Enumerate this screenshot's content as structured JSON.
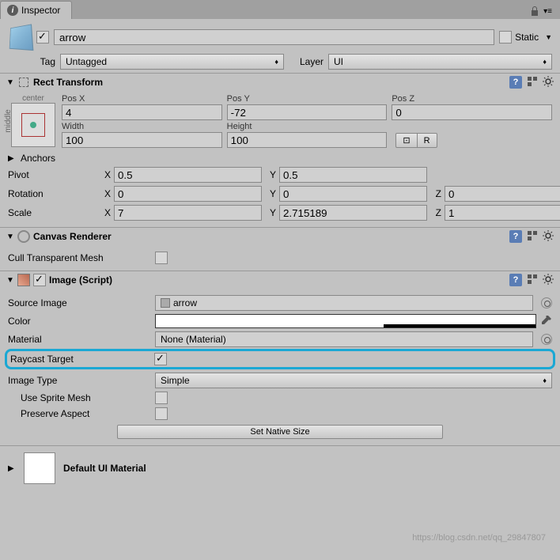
{
  "tab": {
    "title": "Inspector"
  },
  "header": {
    "name": "arrow",
    "active_checked": true,
    "static_label": "Static",
    "static_checked": false,
    "tag_label": "Tag",
    "tag_value": "Untagged",
    "layer_label": "Layer",
    "layer_value": "UI"
  },
  "rect": {
    "title": "Rect Transform",
    "anchor_top": "center",
    "anchor_side": "middle",
    "posx_lbl": "Pos X",
    "posx": "4",
    "posy_lbl": "Pos Y",
    "posy": "-72",
    "posz_lbl": "Pos Z",
    "posz": "0",
    "width_lbl": "Width",
    "width": "100",
    "height_lbl": "Height",
    "height": "100",
    "blueprint_btn": "⊡",
    "raw_btn": "R",
    "anchors_lbl": "Anchors",
    "pivot_lbl": "Pivot",
    "pivot_x": "0.5",
    "pivot_y": "0.5",
    "rotation_lbl": "Rotation",
    "rot_x": "0",
    "rot_y": "0",
    "rot_z": "0",
    "scale_lbl": "Scale",
    "scale_x": "7",
    "scale_y": "2.715189",
    "scale_z": "1",
    "x": "X",
    "y": "Y",
    "z": "Z"
  },
  "canvas": {
    "title": "Canvas Renderer",
    "cull_lbl": "Cull Transparent Mesh",
    "cull_checked": false
  },
  "image": {
    "title": "Image (Script)",
    "enabled_checked": true,
    "src_lbl": "Source Image",
    "src_val": "arrow",
    "color_lbl": "Color",
    "material_lbl": "Material",
    "material_val": "None (Material)",
    "raycast_lbl": "Raycast Target",
    "raycast_checked": true,
    "type_lbl": "Image Type",
    "type_val": "Simple",
    "sprite_mesh_lbl": "Use Sprite Mesh",
    "sprite_mesh_checked": false,
    "preserve_lbl": "Preserve Aspect",
    "preserve_checked": false,
    "native_btn": "Set Native Size"
  },
  "material": {
    "title": "Default UI Material"
  },
  "watermark": "https://blog.csdn.net/qq_29847807"
}
